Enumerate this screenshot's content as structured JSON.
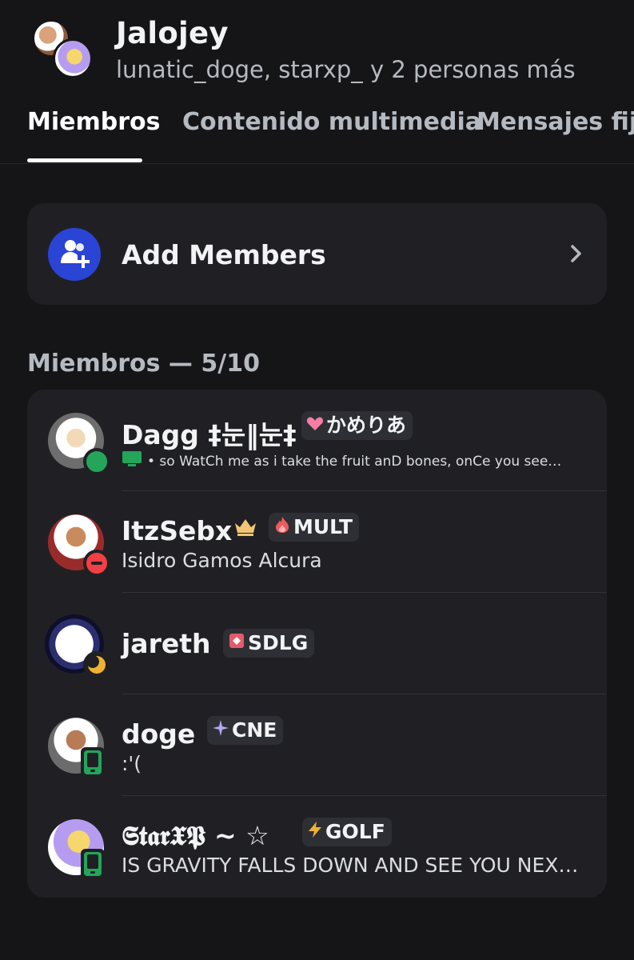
{
  "header": {
    "title": "Jalojey",
    "subtitle": "lunatic_doge, starxp_ y 2 personas más"
  },
  "tabs": [
    {
      "label": "Miembros"
    },
    {
      "label": "Contenido multimedia"
    },
    {
      "label": "Mensajes fijados"
    }
  ],
  "add_members": {
    "label": "Add Members"
  },
  "section": {
    "label": "Miembros — 5/10"
  },
  "members": [
    {
      "name": "Dagg ‡눈‖눈‡",
      "tag": "かめりあ",
      "tag_icon": "heart-icon",
      "status": "online",
      "activity": "• so WatCh me as i take the fruit anD bones, onCe you see…"
    },
    {
      "name": "ItzSebx",
      "tag": "MULT",
      "tag_icon": "fire-icon",
      "status": "dnd",
      "activity": "Isidro Gamos Alcura",
      "owner": true
    },
    {
      "name": "jareth",
      "tag": "SDLG",
      "tag_icon": "shield-icon",
      "status": "idle",
      "activity": ""
    },
    {
      "name": "doge",
      "tag": "CNE",
      "tag_icon": "sparkle-icon",
      "status": "mobile",
      "activity": ":'("
    },
    {
      "name": "𝕾𝖙𝖆𝖗𝖃𝕻 ~ ☆",
      "tag": "GOLF",
      "tag_icon": "lightning-icon",
      "status": "mobile",
      "activity": "IS GRAVITY FALLS DOWN AND SEE YOU NEX…"
    }
  ],
  "colors": {
    "background": "#151518",
    "card": "#202024",
    "accent": "#2a44d6",
    "online": "#23a55a",
    "dnd": "#f23f43",
    "idle": "#f0b232"
  }
}
